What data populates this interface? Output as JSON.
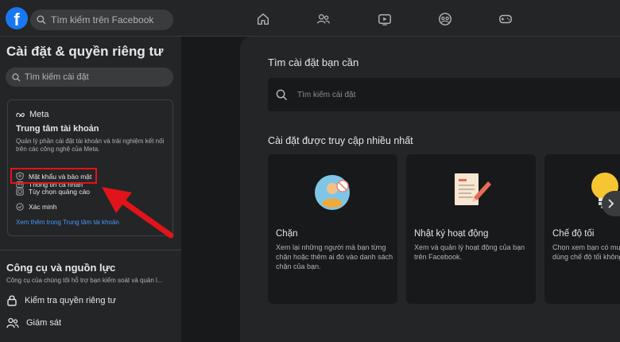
{
  "header": {
    "search_placeholder": "Tìm kiếm trên Facebook",
    "brand_color": "#1877f2"
  },
  "sidebar": {
    "title": "Cài đặt & quyền riêng tư",
    "search_placeholder": "Tìm kiếm cài đặt",
    "meta_card": {
      "logo_text": "Meta",
      "title": "Trung tâm tài khoản",
      "description": "Quản lý phần cài đặt tài khoản và trải nghiệm kết nối trên các công nghệ của Meta.",
      "items": [
        {
          "label": "Thông tin cá nhân",
          "icon": "person-card-icon"
        },
        {
          "label": "Mật khẩu và bảo mật",
          "icon": "shield-icon"
        },
        {
          "label": "Tùy chọn quảng cáo",
          "icon": "ad-icon"
        },
        {
          "label": "Xác minh",
          "icon": "check-circle-icon"
        }
      ],
      "link": "Xem thêm trong Trung tâm tài khoản"
    },
    "tools": {
      "title": "Công cụ và nguồn lực",
      "description": "Công cụ của chúng tôi hỗ trợ bạn kiểm soát và quản l...",
      "items": [
        {
          "label": "Kiểm tra quyền riêng tư",
          "icon": "lock-icon"
        },
        {
          "label": "Giám sát",
          "icon": "people-icon"
        }
      ]
    }
  },
  "main": {
    "search_title": "Tìm cài đặt bạn cần",
    "search_placeholder": "Tìm kiếm cài đặt",
    "most_accessed_title": "Cài đặt được truy cập nhiều nhất",
    "cards": [
      {
        "title": "Chặn",
        "description": "Xem lại những người mà bạn từng chặn hoặc thêm ai đó vào danh sách chặn của bạn.",
        "icon": "blocked-person-icon"
      },
      {
        "title": "Nhật ký hoạt động",
        "description": "Xem và quản lý hoạt động của bạn trên Facebook.",
        "icon": "activity-log-icon"
      },
      {
        "title": "Chế độ tối",
        "description": "Chọn xem bạn có muốn dùng chế độ tối không.",
        "icon": "lightbulb-icon"
      }
    ]
  },
  "annotation": {
    "highlight_color": "#e0141a"
  }
}
